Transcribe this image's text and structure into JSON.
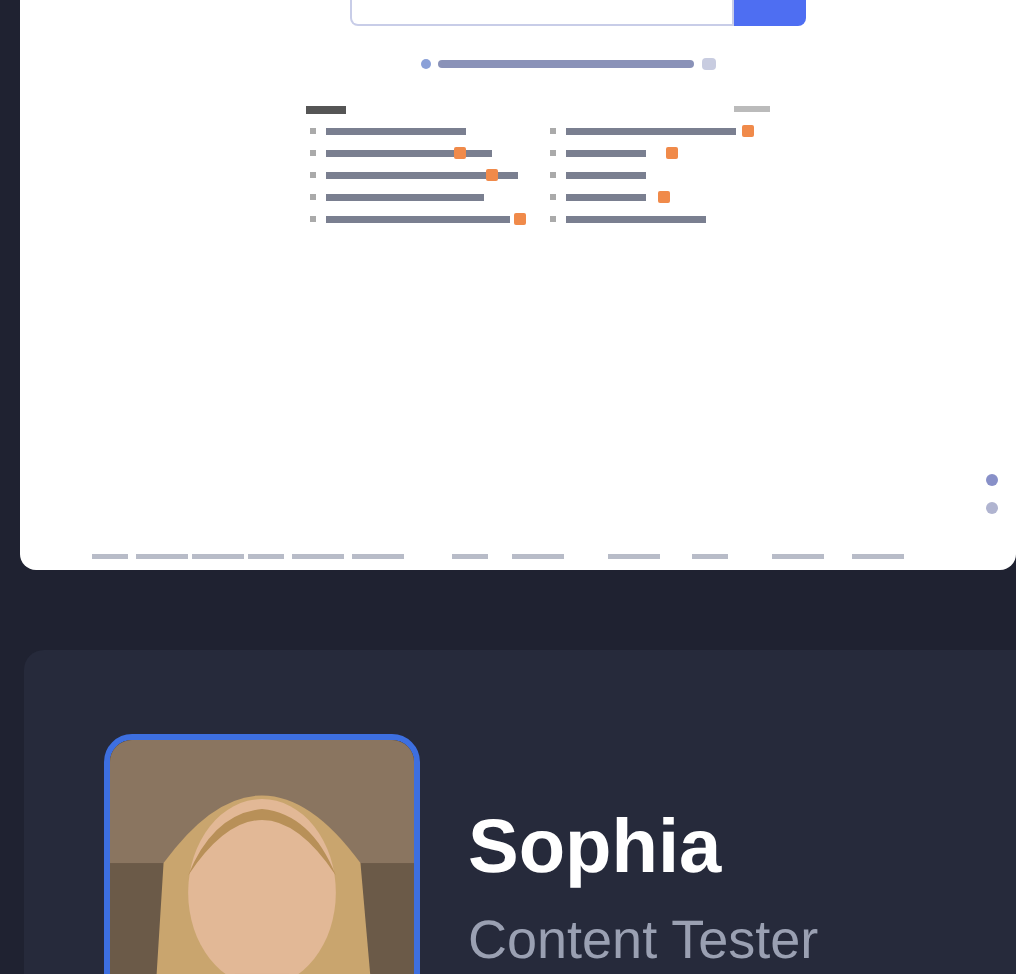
{
  "profile": {
    "name": "Sophia",
    "role": "Content Tester"
  }
}
